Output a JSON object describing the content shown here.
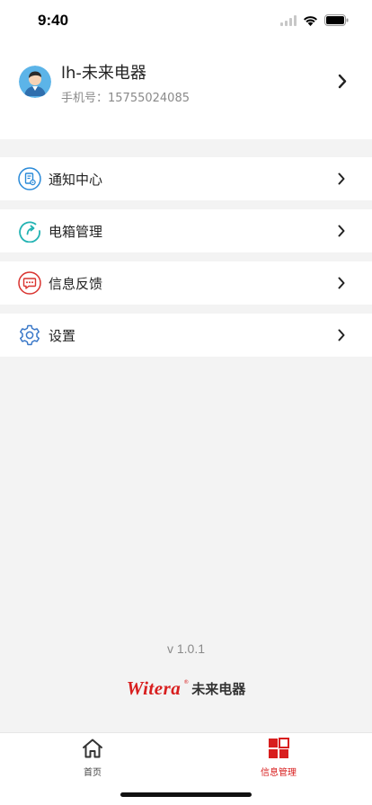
{
  "status_bar": {
    "time": "9:40"
  },
  "profile": {
    "name": "lh-未来电器",
    "phone": "手机号：15755024085"
  },
  "menu": [
    {
      "label": "通知中心",
      "icon": "notification-doc-icon",
      "color": "#2a8ad8"
    },
    {
      "label": "电箱管理",
      "icon": "refresh-arrow-icon",
      "color": "#22b3b3"
    },
    {
      "label": "信息反馈",
      "icon": "chat-bubble-icon",
      "color": "#d9332f"
    },
    {
      "label": "设置",
      "icon": "gear-icon",
      "color": "#3a78c8"
    }
  ],
  "footer": {
    "version": "v 1.0.1",
    "brand_mark": "Witera",
    "brand_reg": "®",
    "brand_cn": "未来电器"
  },
  "tabbar": {
    "tabs": [
      {
        "label": "首页",
        "icon": "home-icon",
        "active": false
      },
      {
        "label": "信息管理",
        "icon": "grid-icon",
        "active": true
      }
    ]
  },
  "colors": {
    "accent": "#d81e1e",
    "background": "#f3f3f3",
    "inactive_tab": "#444444"
  }
}
